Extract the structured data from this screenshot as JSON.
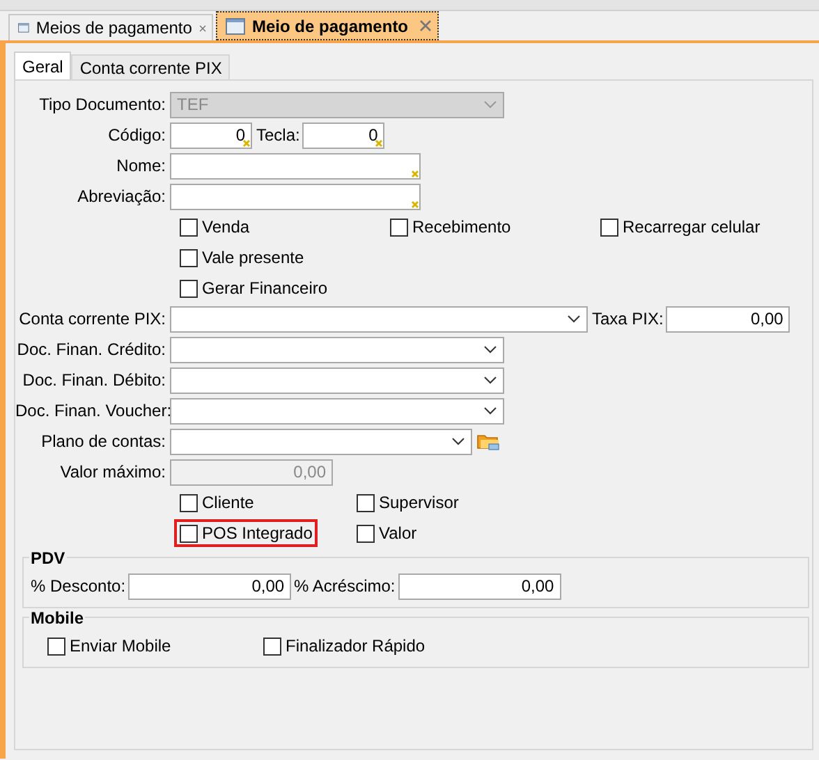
{
  "document_tabs": [
    {
      "label": "Meios de pagamento",
      "selected": false
    },
    {
      "label": "Meio de pagamento",
      "selected": true
    }
  ],
  "form_tabs": [
    {
      "label": "Geral",
      "selected": true
    },
    {
      "label": "Conta corrente PIX",
      "selected": false
    }
  ],
  "tipo_documento": {
    "label": "Tipo Documento:",
    "value": "TEF",
    "disabled": true
  },
  "codigo": {
    "label": "Código:",
    "value": "0",
    "required": true
  },
  "tecla": {
    "label": "Tecla:",
    "value": "0",
    "required": true
  },
  "nome": {
    "label": "Nome:",
    "required": true
  },
  "abreviacao": {
    "label": "Abreviação:",
    "required": true
  },
  "options_a": [
    [
      {
        "label": "Venda",
        "checked": false,
        "highlighted": false
      },
      {
        "label": "Recebimento",
        "checked": false,
        "highlighted": false
      },
      {
        "label": "Recarregar celular",
        "checked": false,
        "highlighted": false
      }
    ],
    [
      {
        "label": "Vale presente",
        "checked": false,
        "highlighted": false
      }
    ],
    [
      {
        "label": "Gerar Financeiro",
        "checked": false,
        "highlighted": false
      }
    ]
  ],
  "conta_corrente_pix": {
    "label": "Conta corrente PIX:"
  },
  "taxa_pix": {
    "label": "Taxa PIX:",
    "value": "0,00"
  },
  "doc_selects": [
    {
      "label": "Doc. Finan. Crédito:"
    },
    {
      "label": "Doc. Finan. Débito:"
    },
    {
      "label": "Doc. Finan. Voucher:"
    }
  ],
  "plano_de_contas": {
    "label": "Plano de contas:"
  },
  "valor_maximo": {
    "label": "Valor máximo:",
    "value": "0,00",
    "disabled": true
  },
  "options_b": [
    [
      {
        "label": "Cliente",
        "checked": false,
        "highlighted": false
      },
      {
        "label": "Supervisor",
        "checked": false,
        "highlighted": false
      }
    ],
    [
      {
        "label": "POS Integrado",
        "checked": false,
        "highlighted": true
      },
      {
        "label": "Valor",
        "checked": false,
        "highlighted": false
      }
    ]
  ],
  "pdv": {
    "title": "PDV",
    "fields": [
      {
        "label": "% Desconto:",
        "value": "0,00"
      },
      {
        "label": "% Acréscimo:",
        "value": "0,00"
      }
    ]
  },
  "mobile": {
    "title": "Mobile",
    "options": [
      {
        "label": "Enviar Mobile",
        "checked": false
      },
      {
        "label": "Finalizador Rápido",
        "checked": false
      }
    ]
  }
}
